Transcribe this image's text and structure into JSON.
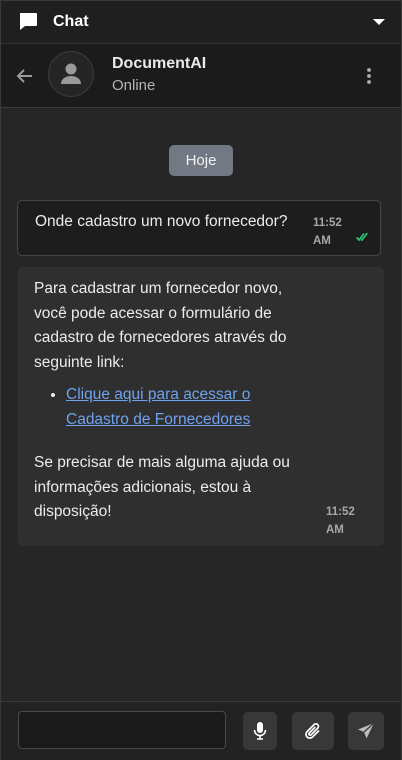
{
  "panel": {
    "title": "Chat",
    "icons": {
      "title": "chat-bubble-icon",
      "collapse": "caret-down-icon"
    }
  },
  "contact": {
    "name": "DocumentAI",
    "status": "Online",
    "icons": {
      "back": "arrow-left-icon",
      "avatar": "user-icon",
      "menu": "more-vertical-icon"
    }
  },
  "conversation": {
    "date_label": "Hoje",
    "messages": [
      {
        "direction": "outgoing",
        "text": "Onde cadastro um novo fornecedor?",
        "time": "11:52 AM",
        "time_line1": "11:52",
        "time_line2": "AM",
        "status_icon": "double-check-icon",
        "status_color": "#2ecc71"
      },
      {
        "direction": "incoming",
        "paragraph1": "Para cadastrar um fornecedor novo, você pode acessar o formulário de cadastro de fornecedores através do seguinte link:",
        "link_text": "Clique aqui para acessar o Cadastro de Fornecedores",
        "paragraph2": "Se precisar de mais alguma ajuda ou informações adicionais, estou à disposição!",
        "time": "11:52 AM",
        "time_line1": "11:52",
        "time_line2": "AM",
        "link_color": "#6fa1ec"
      }
    ]
  },
  "composer": {
    "input_value": "",
    "icons": {
      "mic": "microphone-icon",
      "attach": "paperclip-icon",
      "send": "send-icon"
    }
  }
}
